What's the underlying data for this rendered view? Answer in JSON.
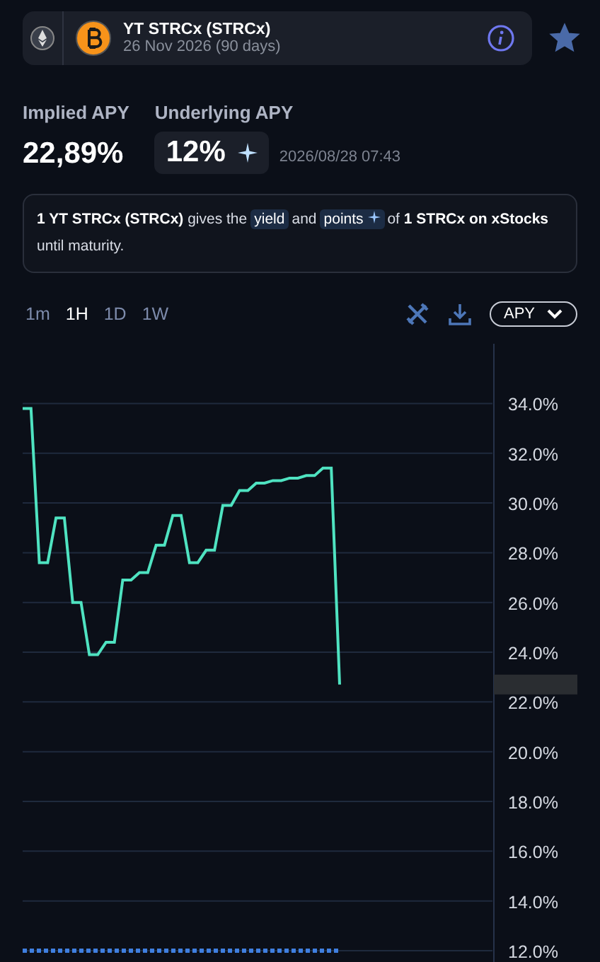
{
  "market": {
    "title": "YT STRCx (STRCx)",
    "subtitle": "26 Nov 2026 (90 days)",
    "favorite": true
  },
  "stats": {
    "implied_label": "Implied APY",
    "implied_value": "22,89%",
    "underlying_label": "Underlying APY",
    "underlying_value": "12%",
    "timestamp": "2026/08/28 07:43"
  },
  "info": "**1 YT STRCx (STRCx)** gives the",
  "info_tag_1": "yield",
  "info_mid": "and",
  "info_tag_2": "points",
  "info_end": "of **1 STRCx on xStocks**",
  "info_end_2": "until maturity.",
  "ranges": [
    {
      "label": "1m",
      "selected": false
    },
    {
      "label": "1H",
      "selected": true
    },
    {
      "label": "1D",
      "selected": false
    },
    {
      "label": "1W",
      "selected": false
    }
  ],
  "metric_select": "APY",
  "chart": {
    "chart_data": {
      "type": "line",
      "grid": true,
      "categories": [
        null,
        null,
        null,
        null,
        null,
        null,
        null,
        null,
        null,
        null,
        null,
        null,
        null,
        null,
        null,
        null,
        null,
        null,
        null,
        null,
        null,
        null,
        null,
        null,
        null,
        null,
        null,
        null,
        null,
        null,
        null,
        null,
        null,
        null,
        null,
        null,
        null,
        null,
        null
      ],
      "series": [
        {
          "color": "#4fe3c1",
          "line_style": "solid",
          "values": [
            33.8,
            33.8,
            27.6,
            27.6,
            29.4,
            29.4,
            26.0,
            26.0,
            23.9,
            23.9,
            24.4,
            24.4,
            26.9,
            26.9,
            27.2,
            27.2,
            28.3,
            28.3,
            29.5,
            29.5,
            27.6,
            27.6,
            28.1,
            28.1,
            29.9,
            29.9,
            30.5,
            30.5,
            30.8,
            30.8,
            30.9,
            30.9,
            31.0,
            31.0,
            31.1,
            31.1,
            31.4,
            31.4,
            22.7
          ]
        },
        {
          "color": "#3f7fe0",
          "line_style": "dashed",
          "values": [
            12,
            12,
            12,
            12,
            12,
            12,
            12,
            12,
            12,
            12,
            12,
            12,
            12,
            12,
            12,
            12,
            12,
            12,
            12,
            12,
            12,
            12,
            12,
            12,
            12,
            12,
            12,
            12,
            12,
            12,
            12,
            12,
            12,
            12,
            12,
            12,
            12,
            12,
            12
          ]
        }
      ],
      "ylim": [
        12,
        36.4
      ],
      "yticks": [
        {
          "value": 34,
          "label": "34.0%"
        },
        {
          "value": 32,
          "label": "32.0%"
        },
        {
          "value": 30,
          "label": "30.0%"
        },
        {
          "value": 28,
          "label": "28.0%"
        },
        {
          "value": 26,
          "label": "26.0%"
        },
        {
          "value": 24,
          "label": "24.0%"
        },
        {
          "value": 22,
          "label": "22.0%"
        },
        {
          "value": 20,
          "label": "20.0%"
        },
        {
          "value": 18,
          "label": "18.0%"
        },
        {
          "value": 16,
          "label": "16.0%"
        },
        {
          "value": 14,
          "label": "14.0%"
        },
        {
          "value": 12,
          "label": "12.0%"
        }
      ]
    }
  }
}
